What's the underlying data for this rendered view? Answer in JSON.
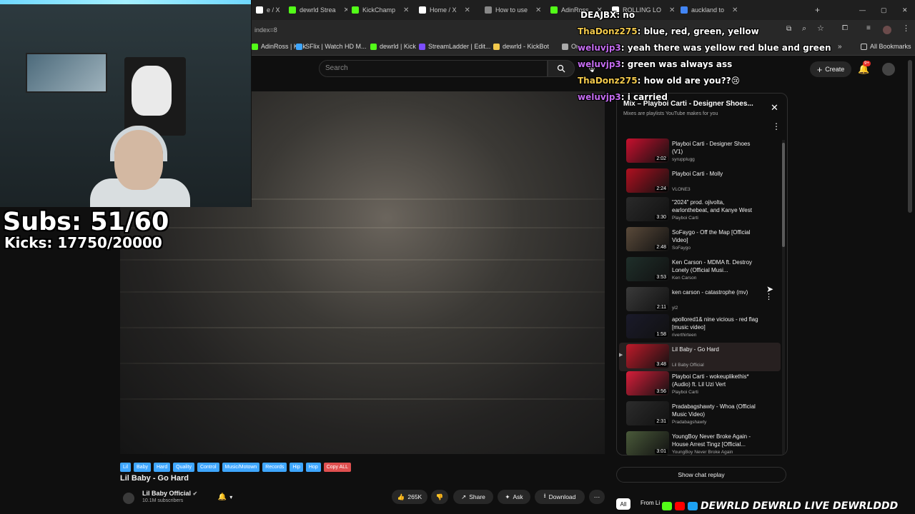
{
  "browser": {
    "tabs": [
      {
        "label": "e / X",
        "color": "#ffffff"
      },
      {
        "label": "dewrld Strea",
        "color": "#53fc18"
      },
      {
        "label": "KickChamp",
        "color": "#53fc18"
      },
      {
        "label": "Home / X",
        "color": "#ffffff"
      },
      {
        "label": "How to use",
        "color": "#888888"
      },
      {
        "label": "AdinRoss",
        "color": "#53fc18"
      },
      {
        "label": "ROLLING LO",
        "color": "#ffffff"
      },
      {
        "label": "auckland to",
        "color": "#4285f4"
      }
    ],
    "url_fragment": "index=8",
    "bookmarks": [
      {
        "label": "AdinRoss | Kick",
        "color": "#53fc18"
      },
      {
        "label": "SFlix | Watch HD M...",
        "color": "#3ea6ff"
      },
      {
        "label": "dewrld | Kick",
        "color": "#53fc18"
      },
      {
        "label": "StreamLadder | Edit...",
        "color": "#7c4dff"
      },
      {
        "label": "dewrld - KickBot",
        "color": "#f2c94c"
      },
      {
        "label": "Ome",
        "color": "#aaaaaa"
      }
    ],
    "all_bookmarks": "All Bookmarks"
  },
  "header": {
    "search_placeholder": "Search",
    "create_label": "Create",
    "notif_badge": "9+"
  },
  "overlay": {
    "subs": "Subs: 51/60",
    "kicks": "Kicks: 17750/20000",
    "chat": [
      {
        "user": "DEAJBX",
        "msg": ": no",
        "cls": "u0"
      },
      {
        "user": "ThaDonz275",
        "msg": ": blue, red, green, yellow",
        "cls": "u1"
      },
      {
        "user": "weluvjp3",
        "msg": ": yeah there was yellow red blue and green",
        "cls": "u2"
      },
      {
        "user": "weluvjp3",
        "msg": ": green was always ass",
        "cls": "u2"
      },
      {
        "user": "ThaDonz275",
        "msg": ": how old are you??😢",
        "cls": "u1"
      },
      {
        "user": "weluvjp3",
        "msg": ": i carried",
        "cls": "u2"
      }
    ]
  },
  "playlist": {
    "title": "Mix – Playboi Carti - Designer Shoes...",
    "subtitle": "Mixes are playlists YouTube makes for you",
    "items": [
      {
        "title": "Playboi Carti - Designer Shoes (V1)",
        "channel": "syrupplugg",
        "duration": "2:02",
        "thumb": "#c8102e"
      },
      {
        "title": "Playboi Carti - Molly",
        "channel": "VLONE3",
        "duration": "2:24",
        "thumb": "#b01020"
      },
      {
        "title": "\"2024\" prod. ojivolta, earlonthebeat, and Kanye West",
        "channel": "Playboi Carti",
        "duration": "3:30",
        "thumb": "#2a2a2a"
      },
      {
        "title": "SoFaygo - Off the Map [Official Video]",
        "channel": "SoFaygo",
        "duration": "2:48",
        "thumb": "#5a4a3a"
      },
      {
        "title": "Ken Carson - MDMA ft. Destroy Lonely (Official Musi...",
        "channel": "Ken Carson",
        "duration": "3:53",
        "thumb": "#1f2f2a"
      },
      {
        "title": "ken carson - catastrophe (mv)",
        "channel": "yl2",
        "duration": "2:11",
        "thumb": "#3a3a3a"
      },
      {
        "title": "apollored1& nine vicious - red flag [music video]",
        "channel": "riverthirteen",
        "duration": "1:58",
        "thumb": "#1a1a2a"
      },
      {
        "title": "Lil Baby - Go Hard",
        "channel": "Lil Baby Official",
        "duration": "3:48",
        "thumb": "#c01a2a"
      },
      {
        "title": "Playboi Carti - wokeuplikethis* (Audio) ft. Lil Uzi Vert",
        "channel": "Playboi Carti",
        "duration": "3:56",
        "thumb": "#d81e3a"
      },
      {
        "title": "Pradabagshawty - Whoa (Official Music Video)",
        "channel": "Pradabagshawty",
        "duration": "2:31",
        "thumb": "#2c2c2c"
      },
      {
        "title": "YoungBoy Never Broke Again - House Arrest Tingz [Official...",
        "channel": "YoungBoy Never Broke Again",
        "duration": "3:01",
        "thumb": "#4a5a3a"
      }
    ],
    "show_chat_replay": "Show chat replay"
  },
  "video": {
    "tags": [
      "Lil",
      "Baby",
      "Hard",
      "Quality",
      "Control",
      "Music/Motown",
      "Records",
      "Hip",
      "Hop"
    ],
    "copy_all": "Copy ALL",
    "title": "Lil Baby - Go Hard",
    "channel": "Lil Baby Official",
    "subscribers": "10.1M subscribers",
    "likes": "265K",
    "share": "Share",
    "ask": "Ask",
    "download": "Download"
  },
  "filters": {
    "all": "All",
    "from": "From Li"
  },
  "banner": "DEWRLD  DEWRLD LIVE  DEWRLDDD"
}
